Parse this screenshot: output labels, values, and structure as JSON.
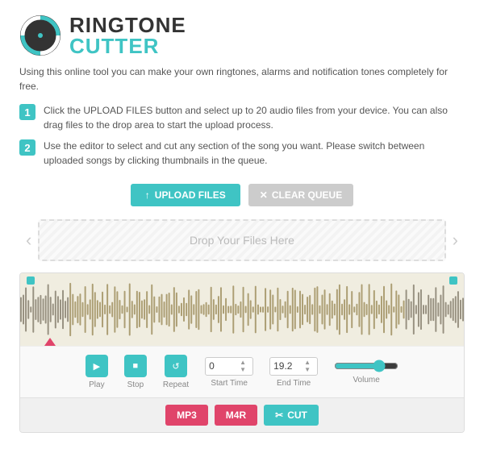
{
  "header": {
    "logo_ringtone": "RINGTONE",
    "logo_cutter": "CUTTER"
  },
  "intro": {
    "text": "Using this online tool you can make your own ringtones, alarms and notification tones completely for free."
  },
  "steps": [
    {
      "number": "1",
      "text": "Click the UPLOAD FILES button and select up to 20 audio files from your device. You can also drag files to the drop area to start the upload process."
    },
    {
      "number": "2",
      "text": "Use the editor to select and cut any section of the song you want. Please switch between uploaded songs by clicking thumbnails in the queue."
    }
  ],
  "buttons": {
    "upload_label": "UPLOAD FILES",
    "clear_label": "CLEAR QUEUE"
  },
  "drop_zone": {
    "text": "Drop Your Files Here",
    "nav_left": "‹",
    "nav_right": "›"
  },
  "controls": {
    "play_label": "Play",
    "stop_label": "Stop",
    "repeat_label": "Repeat",
    "start_time_label": "Start Time",
    "start_time_value": "0",
    "end_time_label": "End Time",
    "end_time_value": "19.2",
    "volume_label": "Volume",
    "volume_value": 75
  },
  "format_buttons": {
    "mp3_label": "MP3",
    "m4r_label": "M4R",
    "cut_label": "CUT"
  },
  "icons": {
    "upload_arrow": "↑",
    "clear_x": "✕",
    "play_triangle": "▶",
    "stop_square": "■",
    "repeat_arrows": "↺",
    "cut_scissors": "✂",
    "spinner_up": "▲",
    "spinner_down": "▼"
  }
}
